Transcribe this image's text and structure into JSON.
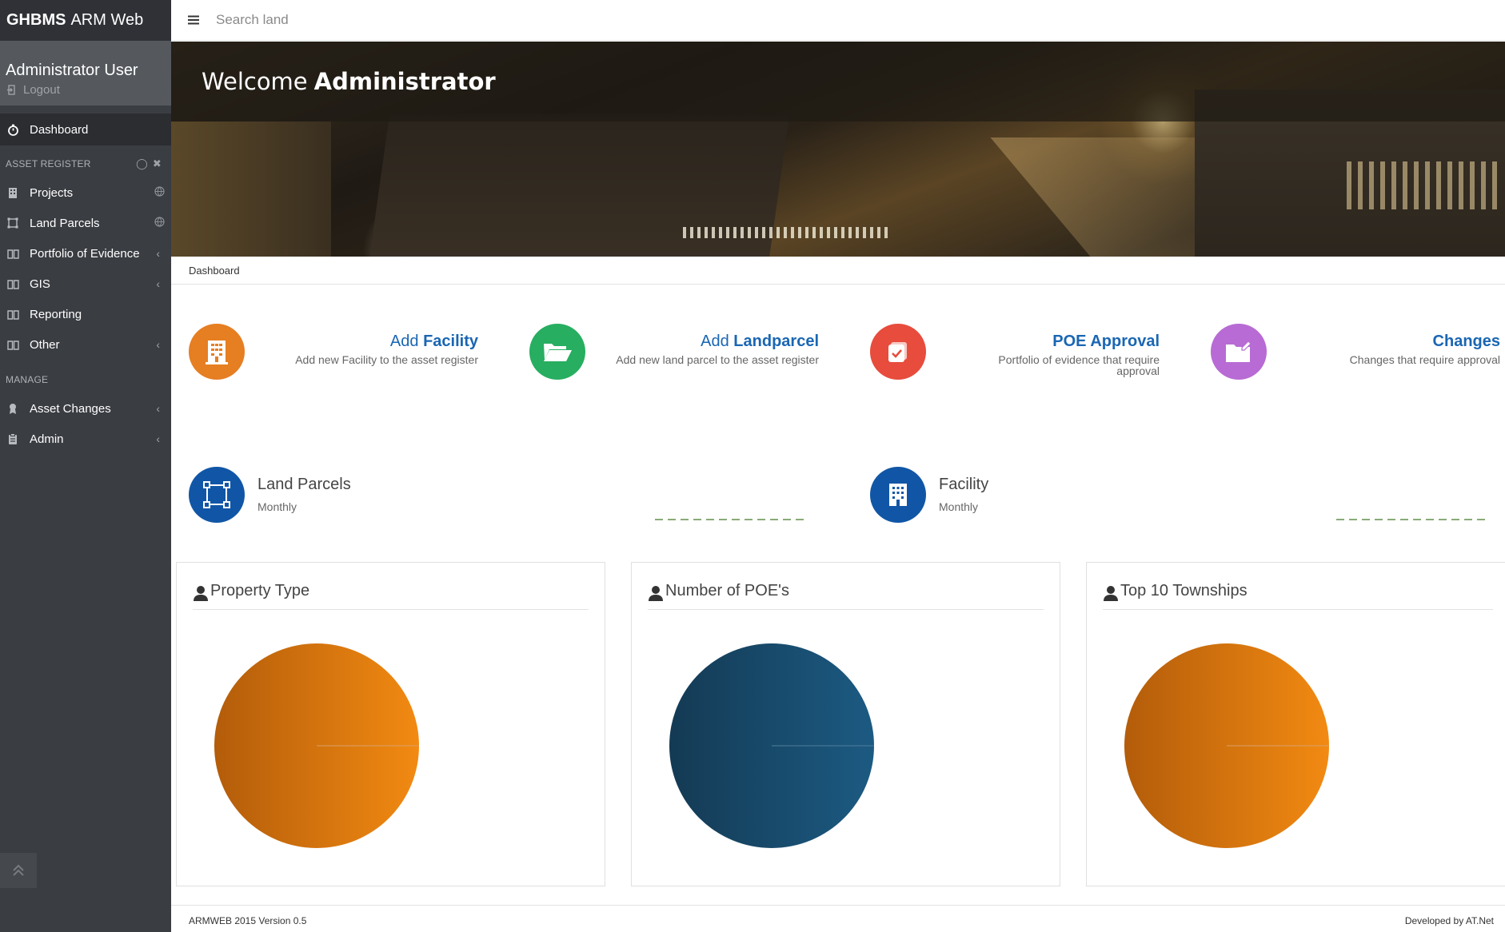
{
  "brand": {
    "bold": "GHBMS",
    "rest": "ARM Web"
  },
  "user": {
    "name": "Administrator User",
    "logout": "Logout"
  },
  "sidebar": {
    "dashboard": "Dashboard",
    "section_asset": "ASSET REGISTER",
    "asset_items": [
      {
        "label": "Projects",
        "icon": "building-icon"
      },
      {
        "label": "Land Parcels",
        "icon": "vector-square-icon"
      },
      {
        "label": "Portfolio of Evidence",
        "icon": "book-icon"
      },
      {
        "label": "GIS",
        "icon": "book-icon"
      },
      {
        "label": "Reporting",
        "icon": "book-icon"
      },
      {
        "label": "Other",
        "icon": "book-icon"
      }
    ],
    "section_manage": "MANAGE",
    "manage_items": [
      {
        "label": "Asset Changes",
        "icon": "award-icon"
      },
      {
        "label": "Admin",
        "icon": "clipboard-icon"
      }
    ]
  },
  "topbar": {
    "search_placeholder": "Search land"
  },
  "banner": {
    "welcome": "Welcome",
    "user": "Administrator"
  },
  "breadcrumb": "Dashboard",
  "quick_actions": [
    {
      "prefix": "Add",
      "bold": "Facility",
      "desc": "Add new Facility to the asset register",
      "color": "#e67e22"
    },
    {
      "prefix": "Add",
      "bold": "Landparcel",
      "desc": "Add new land parcel to the asset register",
      "color": "#27ae60"
    },
    {
      "prefix": "",
      "bold": "POE Approval",
      "desc": "Portfolio of evidence that require approval",
      "color": "#e74c3c"
    },
    {
      "prefix": "",
      "bold": "Changes",
      "desc": "Changes that require approval",
      "color": "#b86bd4"
    }
  ],
  "stats": [
    {
      "name": "Land Parcels",
      "period": "Monthly"
    },
    {
      "name": "Facility",
      "period": "Monthly"
    }
  ],
  "panels": [
    {
      "title": "Property Type",
      "color_dark": "#b35c0a",
      "color_light": "#f28a12"
    },
    {
      "title": "Number of POE's",
      "color_dark": "#143a54",
      "color_light": "#1c5a82"
    },
    {
      "title": "Top 10 Townships",
      "color_dark": "#b35c0a",
      "color_light": "#f28a12"
    }
  ],
  "footer": {
    "left": "ARMWEB 2015 Version 0.5",
    "right": "Developed by AT.Net"
  }
}
